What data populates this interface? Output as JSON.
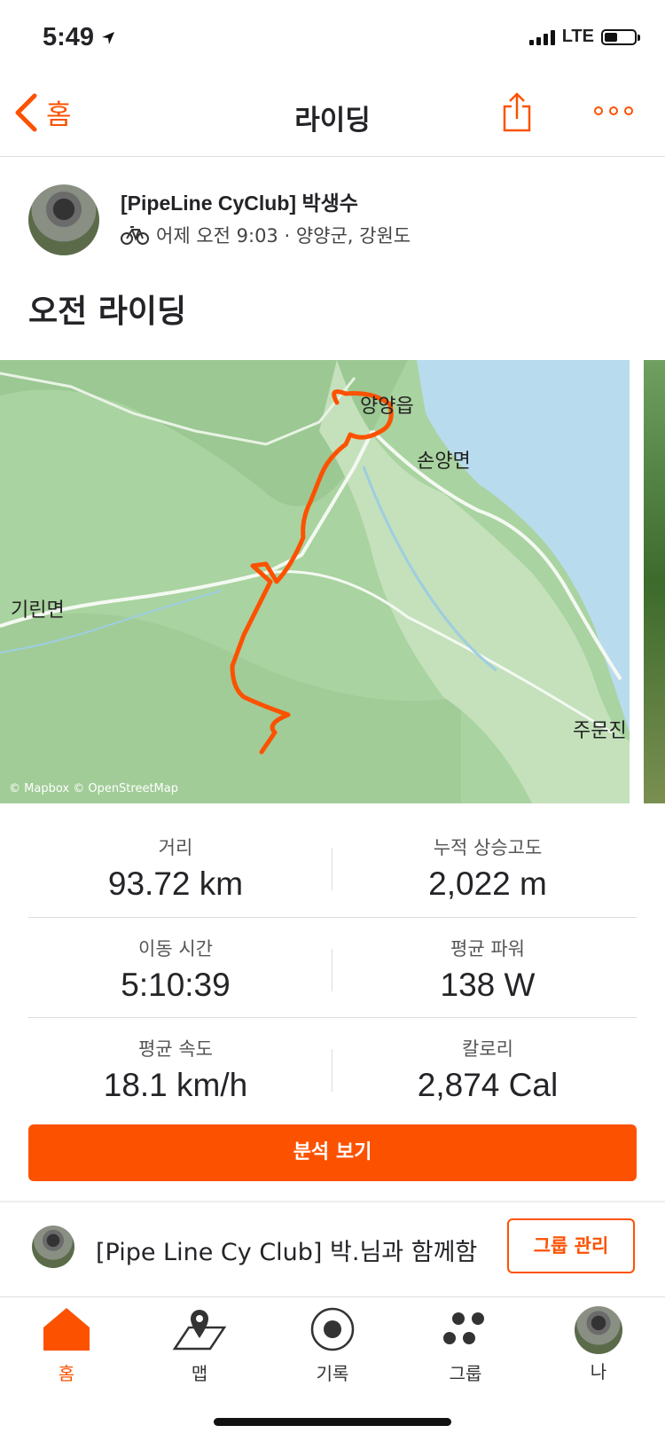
{
  "status_bar": {
    "time": "5:49",
    "network": "LTE"
  },
  "nav": {
    "back_label": "홈",
    "title": "라이딩"
  },
  "activity": {
    "athlete": "[PipeLine CyClub] 박생수",
    "meta": "어제 오전 9:03 · 양양군, 강원도",
    "title": "오전 라이딩"
  },
  "map": {
    "labels": {
      "town1": "양양읍",
      "town2": "손양면",
      "town3": "기린면",
      "town4": "주문진"
    },
    "attribution": "© Mapbox © OpenStreetMap"
  },
  "stats": [
    {
      "label": "거리",
      "value": "93.72 km"
    },
    {
      "label": "누적 상승고도",
      "value": "2,022 m"
    },
    {
      "label": "이동 시간",
      "value": "5:10:39"
    },
    {
      "label": "평균 파워",
      "value": "138 W"
    },
    {
      "label": "평균 속도",
      "value": "18.1 km/h"
    },
    {
      "label": "칼로리",
      "value": "2,874 Cal"
    }
  ],
  "analysis_button": "분석 보기",
  "group": {
    "text": "[Pipe Line Cy Club] 박.님과 함께함",
    "button": "그룹 관리"
  },
  "tabs": [
    {
      "label": "홈",
      "icon": "home-icon",
      "active": true
    },
    {
      "label": "맵",
      "icon": "map-icon",
      "active": false
    },
    {
      "label": "기록",
      "icon": "record-icon",
      "active": false
    },
    {
      "label": "그룹",
      "icon": "groups-icon",
      "active": false
    },
    {
      "label": "나",
      "icon": "profile-avatar",
      "active": false
    }
  ],
  "colors": {
    "accent": "#fc5200",
    "water": "#b9dbee",
    "land": "#a9d3a0"
  }
}
